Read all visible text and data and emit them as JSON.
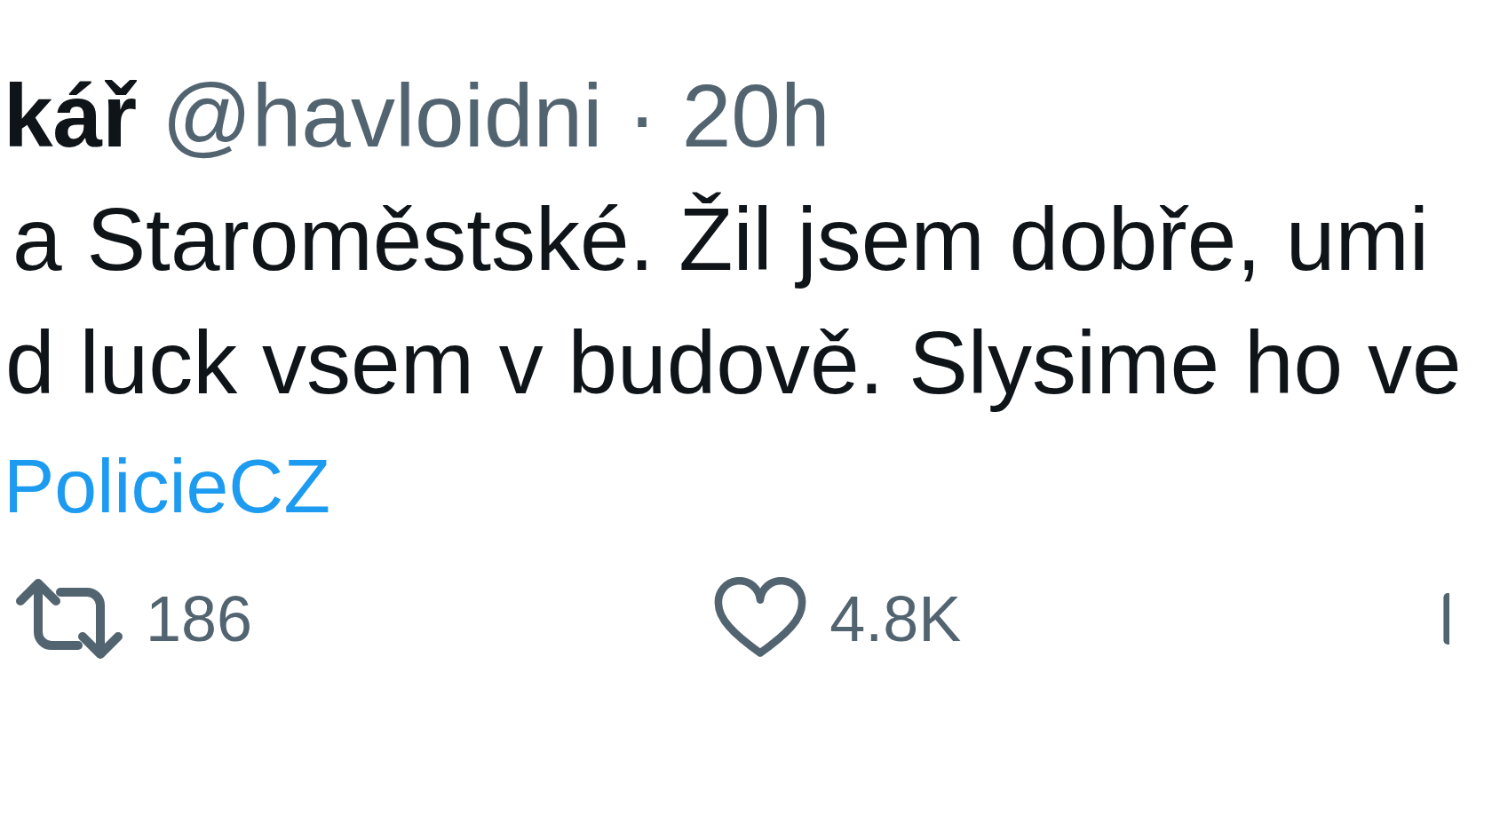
{
  "tweet": {
    "author_name": "kář",
    "handle": "@havloidni",
    "separator": "·",
    "time": "20h",
    "text_lines": [
      "a Staroměstské. Žil jsem dobře, umi",
      "d luck vsem v budově. Slysime ho ve"
    ],
    "link": "PolicieCZ",
    "actions": [
      {
        "kind": "retweet",
        "count": "186"
      },
      {
        "kind": "like",
        "count": "4.8K"
      },
      {
        "kind": "views"
      }
    ]
  }
}
